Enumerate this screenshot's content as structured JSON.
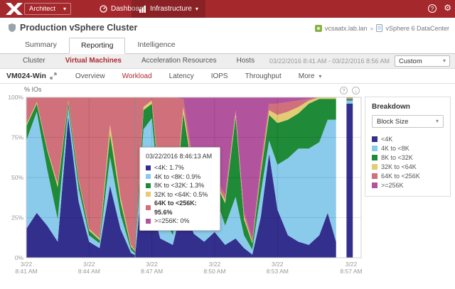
{
  "topbar": {
    "product": "Architect",
    "nav": [
      {
        "label": "Dashboard"
      },
      {
        "label": "Infrastructure"
      }
    ]
  },
  "header": {
    "title": "Production vSphere Cluster",
    "separator": "»",
    "breadcrumb": [
      {
        "label": "vcsaatx.lab.lan"
      },
      {
        "label": "vSphere 6 DataCenter"
      }
    ]
  },
  "tabs": {
    "items": [
      "Summary",
      "Reporting",
      "Intelligence"
    ],
    "active": "Reporting"
  },
  "subtabs": {
    "items": [
      "Cluster",
      "Virtual Machines",
      "Acceleration Resources",
      "Hosts"
    ],
    "active": "Virtual Machines",
    "date_range": "03/22/2016 8:41 AM - 03/22/2016 8:56 AM",
    "range_value": "Custom"
  },
  "vm": {
    "name": "VM024-Win",
    "tabs": [
      "Overview",
      "Workload",
      "Latency",
      "IOPS",
      "Throughput"
    ],
    "more_label": "More",
    "active": "Workload"
  },
  "tooltip": {
    "title": "03/22/2016 8:46:13 AM",
    "rows": [
      {
        "text": "<4K: 1.7%"
      },
      {
        "text": "4K to <8K: 0.9%"
      },
      {
        "text": "8K to <32K: 1.3%"
      },
      {
        "text": "32K to <64K: 0.5%"
      },
      {
        "text": "64K to <256K: 95.6%"
      },
      {
        "text": ">=256K: 0%"
      }
    ]
  },
  "breakdown": {
    "title": "Breakdown",
    "select_value": "Block Size"
  },
  "chart_data": {
    "type": "area",
    "stacked": true,
    "percent": true,
    "ylabel": "% IOs",
    "ylim": [
      0,
      100
    ],
    "x_span": 16,
    "hover_t": 5.2,
    "grid": true,
    "legend_position": "right",
    "yticks": [
      {
        "v": 100,
        "label": "100%"
      },
      {
        "v": 75,
        "label": "75%"
      },
      {
        "v": 50,
        "label": "50%"
      },
      {
        "v": 25,
        "label": "25%"
      },
      {
        "v": 0,
        "label": "0%"
      }
    ],
    "xticks": [
      {
        "t": 0,
        "l1": "3/22",
        "l2": "8:41 AM",
        "grid": false
      },
      {
        "t": 3,
        "l1": "3/22",
        "l2": "8:44 AM",
        "grid": true
      },
      {
        "t": 6,
        "l1": "3/22",
        "l2": "8:47 AM",
        "grid": true
      },
      {
        "t": 9,
        "l1": "3/22",
        "l2": "8:50 AM",
        "grid": true
      },
      {
        "t": 12,
        "l1": "3/22",
        "l2": "8:53 AM",
        "grid": true
      },
      {
        "t": 16,
        "l1": "3/22",
        "l2": "8:57 AM",
        "grid": false
      }
    ],
    "t": [
      0,
      0.5,
      1,
      1.5,
      2,
      2.5,
      3,
      3.5,
      4,
      4.5,
      5,
      5.2,
      5.6,
      6,
      6.4,
      7,
      7.5,
      8,
      8.5,
      9,
      9.5,
      10,
      10.4,
      10.8,
      11.2,
      11.6,
      12,
      12.5,
      13,
      13.5,
      14,
      14.4,
      14.8,
      15.05,
      15.3,
      15.6,
      15.85
    ],
    "series": [
      {
        "name": "<4K",
        "color": "#332f8c",
        "values": [
          18,
          28,
          20,
          10,
          88,
          35,
          10,
          6,
          45,
          18,
          3,
          1.7,
          55,
          32,
          12,
          8,
          35,
          15,
          10,
          16,
          8,
          12,
          6,
          2,
          25,
          65,
          30,
          14,
          10,
          8,
          14,
          28,
          10,
          null,
          96,
          96,
          null
        ]
      },
      {
        "name": "4K to <8K",
        "color": "#8acbec",
        "values": [
          55,
          63,
          35,
          14,
          6,
          8,
          4,
          3,
          18,
          9,
          2,
          0.9,
          25,
          55,
          18,
          6,
          30,
          25,
          12,
          24,
          12,
          26,
          8,
          3,
          15,
          8,
          28,
          48,
          58,
          60,
          58,
          58,
          76,
          null,
          2,
          2,
          null
        ]
      },
      {
        "name": "8K to <32K",
        "color": "#1f8a37",
        "values": [
          9,
          5,
          12,
          20,
          3,
          5,
          3,
          2,
          14,
          8,
          2,
          1.3,
          12,
          9,
          10,
          4,
          25,
          10,
          6,
          8,
          14,
          50,
          10,
          4,
          12,
          16,
          26,
          24,
          22,
          28,
          27,
          13,
          13,
          null,
          1,
          1,
          null
        ]
      },
      {
        "name": "32K to <64K",
        "color": "#e2cc74",
        "values": [
          1,
          1,
          1,
          2,
          1,
          1,
          1,
          1,
          6,
          3,
          1,
          0.5,
          2,
          2,
          3,
          2,
          4,
          2,
          1,
          1,
          2,
          2,
          2,
          1,
          2,
          3,
          5,
          5,
          4,
          2,
          1,
          1,
          1,
          null,
          0.3,
          0.3,
          null
        ]
      },
      {
        "name": "64K to <256K",
        "color": "#d0707a",
        "values": [
          17,
          3,
          32,
          54,
          2,
          51,
          82,
          88,
          17,
          62,
          92,
          95.6,
          6,
          2,
          57,
          80,
          5,
          6,
          4,
          3,
          3,
          2,
          3,
          2,
          4,
          4,
          7,
          6,
          4,
          1,
          0,
          0,
          0,
          null,
          0.7,
          0.7,
          null
        ]
      },
      {
        "name": ">=256K",
        "color": "#b2539e",
        "values": [
          0,
          0,
          0,
          0,
          0,
          0,
          0,
          0,
          0,
          0,
          0,
          0,
          0,
          0,
          0,
          0,
          1,
          42,
          67,
          48,
          61,
          8,
          71,
          88,
          42,
          4,
          4,
          3,
          2,
          1,
          0,
          0,
          0,
          null,
          0,
          0,
          null
        ]
      }
    ]
  }
}
